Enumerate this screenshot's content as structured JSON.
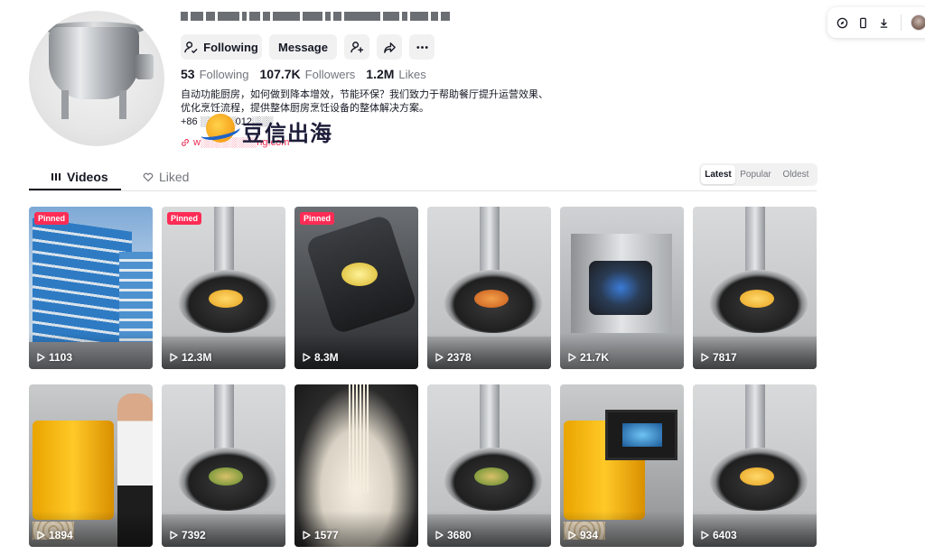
{
  "profile": {
    "following_button": "Following",
    "message_button": "Message",
    "stats": {
      "following_count": "53",
      "following_label": "Following",
      "followers_count": "107.7K",
      "followers_label": "Followers",
      "likes_count": "1.2M",
      "likes_label": "Likes"
    },
    "bio_line1": "自动功能厨房，如何做到降本增效，节能环保？我们致力于帮助餐厅提升运营效果、",
    "bio_line2": "优化烹饪流程，提供整体厨房烹饪设备的整体解决方案。",
    "phone": "+86 ░░░░░012░░░",
    "link": "w░░░░░░░░ng.com",
    "watermark": "豆信出海"
  },
  "tabs": {
    "videos": "Videos",
    "liked": "Liked"
  },
  "sort": {
    "latest": "Latest",
    "popular": "Popular",
    "oldest": "Oldest"
  },
  "videos": [
    {
      "views": "1103",
      "pinned": "Pinned",
      "icon": "play-icon"
    },
    {
      "views": "12.3M",
      "pinned": "Pinned",
      "icon": "play-icon"
    },
    {
      "views": "8.3M",
      "pinned": "Pinned",
      "icon": "play-icon"
    },
    {
      "views": "2378",
      "icon": "play-icon"
    },
    {
      "views": "21.7K",
      "icon": "play-icon"
    },
    {
      "views": "7817",
      "icon": "play-icon"
    },
    {
      "views": "1894",
      "icon": "play-icon"
    },
    {
      "views": "7392",
      "icon": "play-icon"
    },
    {
      "views": "1577",
      "icon": "play-icon"
    },
    {
      "views": "3680",
      "icon": "play-icon"
    },
    {
      "views": "934",
      "icon": "play-icon"
    },
    {
      "views": "6403",
      "icon": "play-icon"
    }
  ],
  "colors": {
    "accent": "#fe2c55",
    "text_primary": "#161823",
    "text_secondary": "#73757c",
    "button_bg": "#f1f1f2"
  }
}
